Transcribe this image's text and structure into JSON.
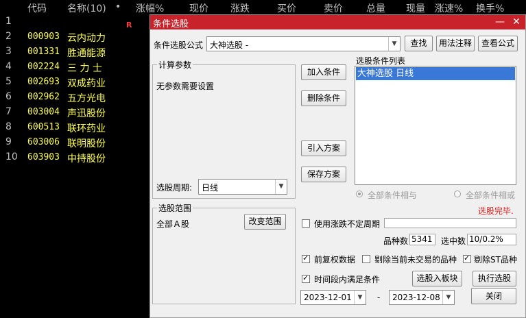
{
  "header": {
    "code": "代码",
    "name": "名称(10)",
    "dot": "•",
    "pct": "涨幅%",
    "price": "现价",
    "change": "涨跌",
    "bid": "买价",
    "ask": "卖价",
    "volume": "总量",
    "curvol": "现量",
    "speed": "涨速%",
    "turnover": "换手%"
  },
  "stocks": [
    {
      "idx": "1",
      "code": "",
      "name": ""
    },
    {
      "idx": "2",
      "code": "000903",
      "name": "云内动力"
    },
    {
      "idx": "3",
      "code": "001331",
      "name": "胜通能源"
    },
    {
      "idx": "4",
      "code": "002224",
      "name": "三 力 士"
    },
    {
      "idx": "5",
      "code": "002693",
      "name": "双成药业"
    },
    {
      "idx": "6",
      "code": "002962",
      "name": "五方光电"
    },
    {
      "idx": "7",
      "code": "003004",
      "name": "声迅股份"
    },
    {
      "idx": "8",
      "code": "600513",
      "name": "联环药业"
    },
    {
      "idx": "9",
      "code": "603006",
      "name": "联明股份"
    },
    {
      "idx": "10",
      "code": "603903",
      "name": "中持股份"
    }
  ],
  "r_mark": "R",
  "dialog": {
    "title": "条件选股",
    "min_icon": "—",
    "close_icon": "✕",
    "formula_label": "条件选股公式",
    "formula_value": "大神选股     -",
    "find_btn": "查找",
    "usage_btn": "用法注释",
    "view_formula_btn": "查看公式",
    "calc_params_title": "计算参数",
    "no_params": "无参数需要设置",
    "period_label": "选股周期:",
    "period_value": "日线",
    "add_condition": "加入条件",
    "delete_condition": "删除条件",
    "import_plan": "引入方案",
    "save_plan": "保存方案",
    "conditions_title": "选股条件列表",
    "condition_item": "大神选股  日线",
    "all_and": "全部条件相与",
    "all_or": "全部条件相或",
    "done_status": "选股完毕.",
    "range_title": "选股范围",
    "range_value": "全部Ａ股",
    "change_range": "改变范围",
    "use_period": "使用涨跌不定周期",
    "count_label": "品种数",
    "count_value": "5341",
    "selected_label": "选中数",
    "selected_value": "10/0.2%",
    "pre_adjust": "前复权数据",
    "remove_untraded": "剔除当前未交易的品种",
    "remove_st": "剔除ST品种",
    "within_period": "时间段内满足条件",
    "to_board": "选股入板块",
    "execute": "执行选股",
    "start_date": "2023-12-01",
    "dash": "-",
    "end_date": "2023-12-08",
    "close_btn": "关闭"
  },
  "colors": {
    "title_red": "#c8232b",
    "status_red": "#e02020",
    "stock_yellow": "#ffff54",
    "selection_blue": "#3a78d8"
  }
}
